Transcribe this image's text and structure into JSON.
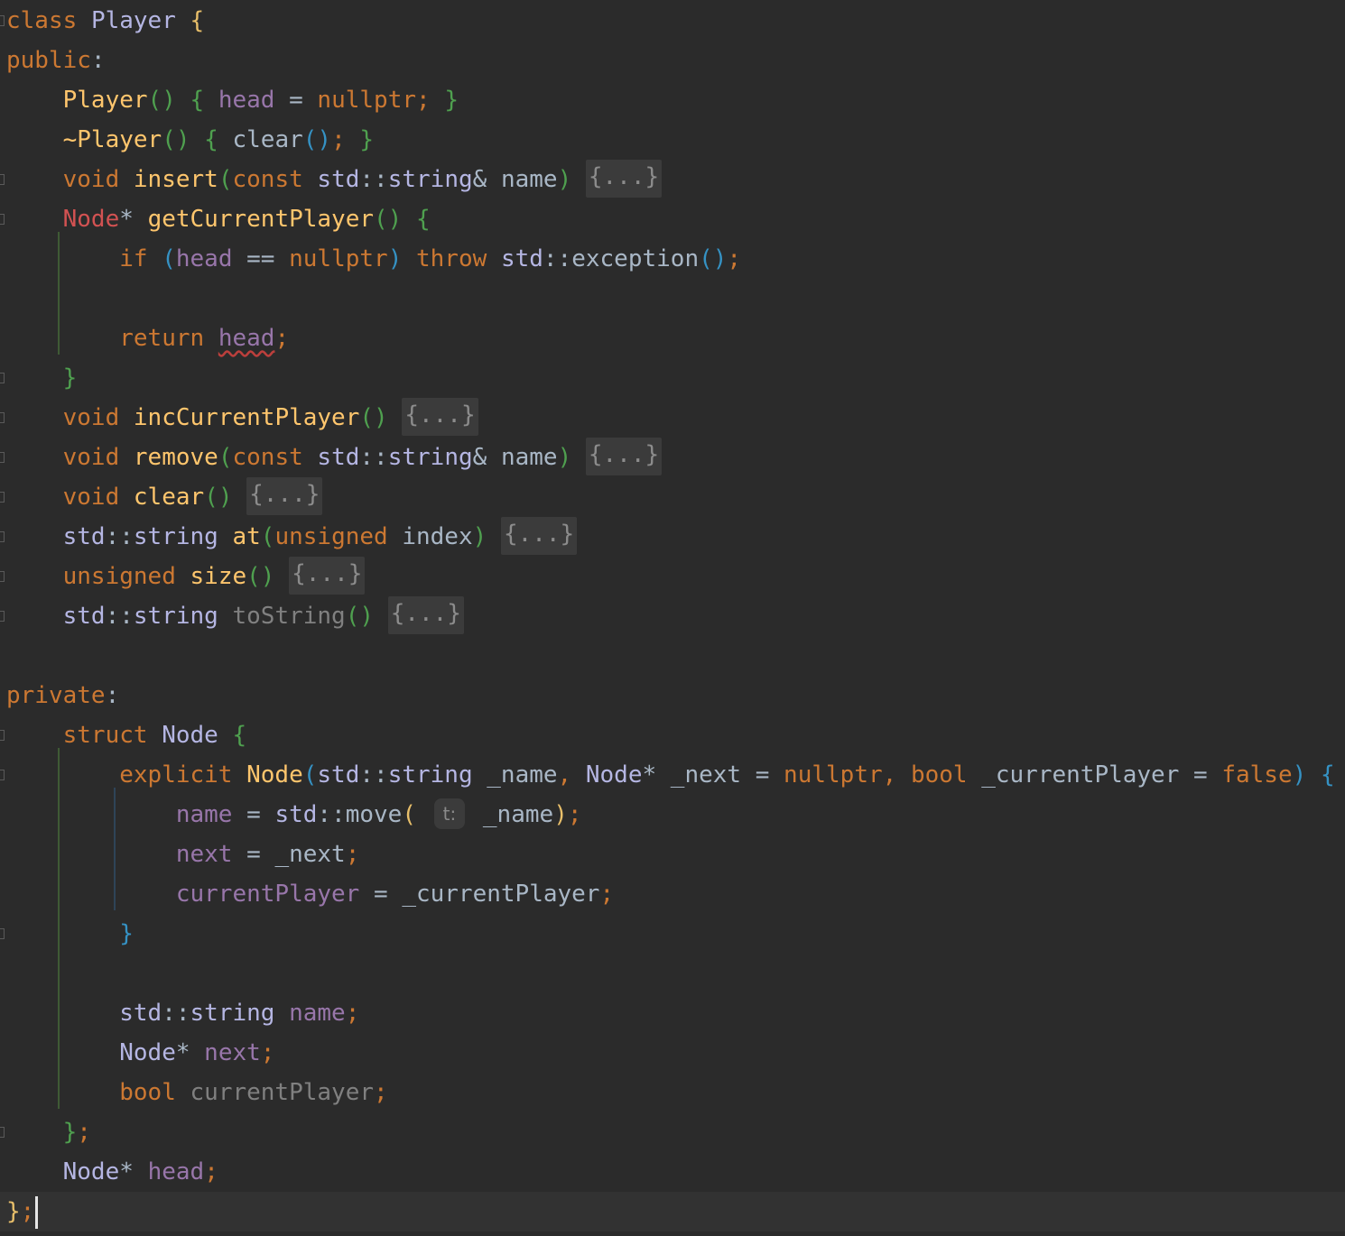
{
  "editor": {
    "language": "C++",
    "theme_background": "#2b2b2b",
    "current_line_background": "#323232",
    "colors": {
      "keyword": "#cc7832",
      "class_name": "#b5b6e3",
      "function": "#ffc66d",
      "field": "#9876aa",
      "brace_level1": "#e8bf6a",
      "brace_level2": "#4fa04f",
      "brace_level3": "#3592c4",
      "error": "#d25252",
      "text": "#a9b7c6"
    },
    "inlay_hint": "t:",
    "folded_placeholder": "{...}",
    "lines": [
      "class Player {",
      "public:",
      "    Player() { head = nullptr; }",
      "    ~Player() { clear(); }",
      "    void insert(const std::string& name) {...}",
      "    Node* getCurrentPlayer() {",
      "        if (head == nullptr) throw std::exception();",
      "",
      "        return head;",
      "    }",
      "    void incCurrentPlayer() {...}",
      "    void remove(const std::string& name) {...}",
      "    void clear() {...}",
      "    std::string at(unsigned index) {...}",
      "    unsigned size() {...}",
      "    std::string toString() {...}",
      "",
      "private:",
      "    struct Node {",
      "        explicit Node(std::string _name, Node* _next = nullptr, bool _currentPlayer = false) {",
      "            name = std::move( t: _name);",
      "            next = _next;",
      "            currentPlayer = _currentPlayer;",
      "        }",
      "",
      "        std::string name;",
      "        Node* next;",
      "        bool currentPlayer;",
      "    };",
      "    Node* head;",
      "};"
    ]
  }
}
